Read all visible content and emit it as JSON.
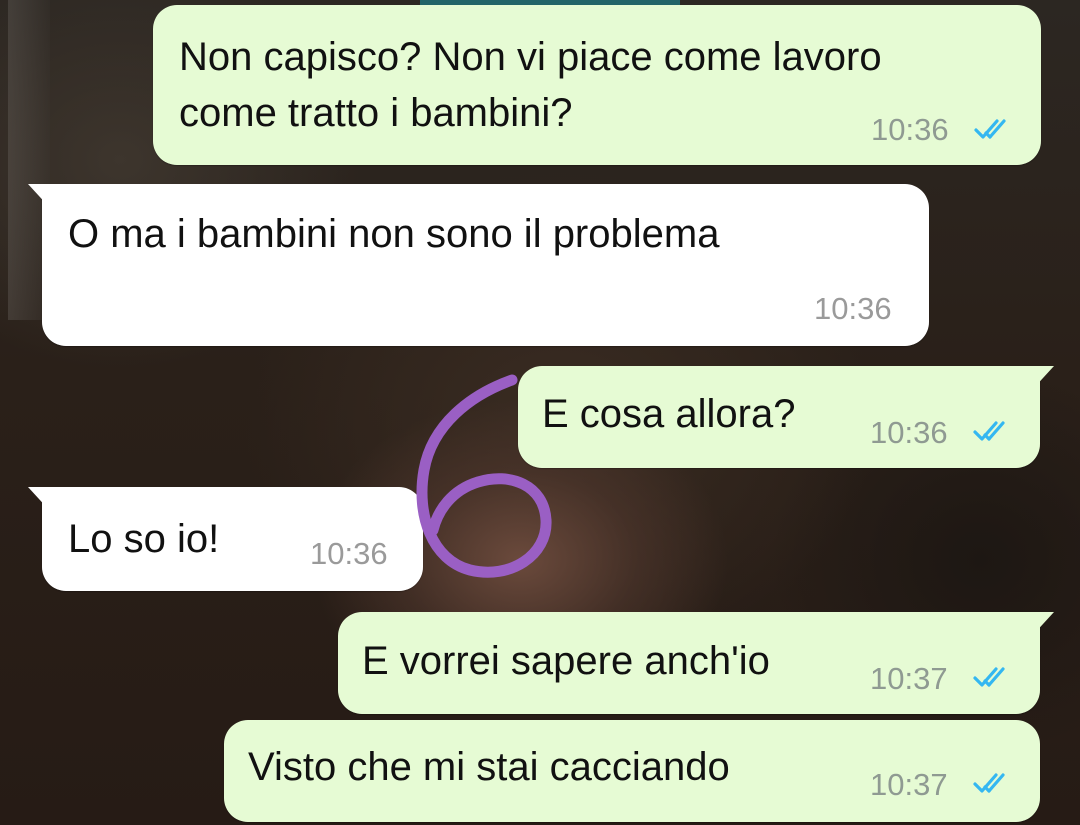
{
  "chat": {
    "messages": [
      {
        "direction": "outgoing",
        "text": "Non capisco? Non vi piace come lavoro\ncome tratto i bambini?",
        "time": "10:36",
        "status": "read"
      },
      {
        "direction": "incoming",
        "text": "O ma i bambini non sono il problema",
        "time": "10:36"
      },
      {
        "direction": "outgoing",
        "text": "E cosa allora?",
        "time": "10:36",
        "status": "read"
      },
      {
        "direction": "incoming",
        "text": "Lo so io!",
        "time": "10:36"
      },
      {
        "direction": "outgoing",
        "text": "E vorrei sapere anch'io",
        "time": "10:37",
        "status": "read"
      },
      {
        "direction": "outgoing",
        "text": "Visto che mi stai cacciando",
        "time": "10:37",
        "status": "read"
      }
    ]
  },
  "colors": {
    "outgoing_bubble": "#e6fbd4",
    "incoming_bubble": "#ffffff",
    "read_ticks": "#34b7f1",
    "annotation": "#9a5fc4"
  },
  "icons": {
    "read_receipt": "double-check-icon",
    "annotation": "handwritten-number-icon"
  }
}
